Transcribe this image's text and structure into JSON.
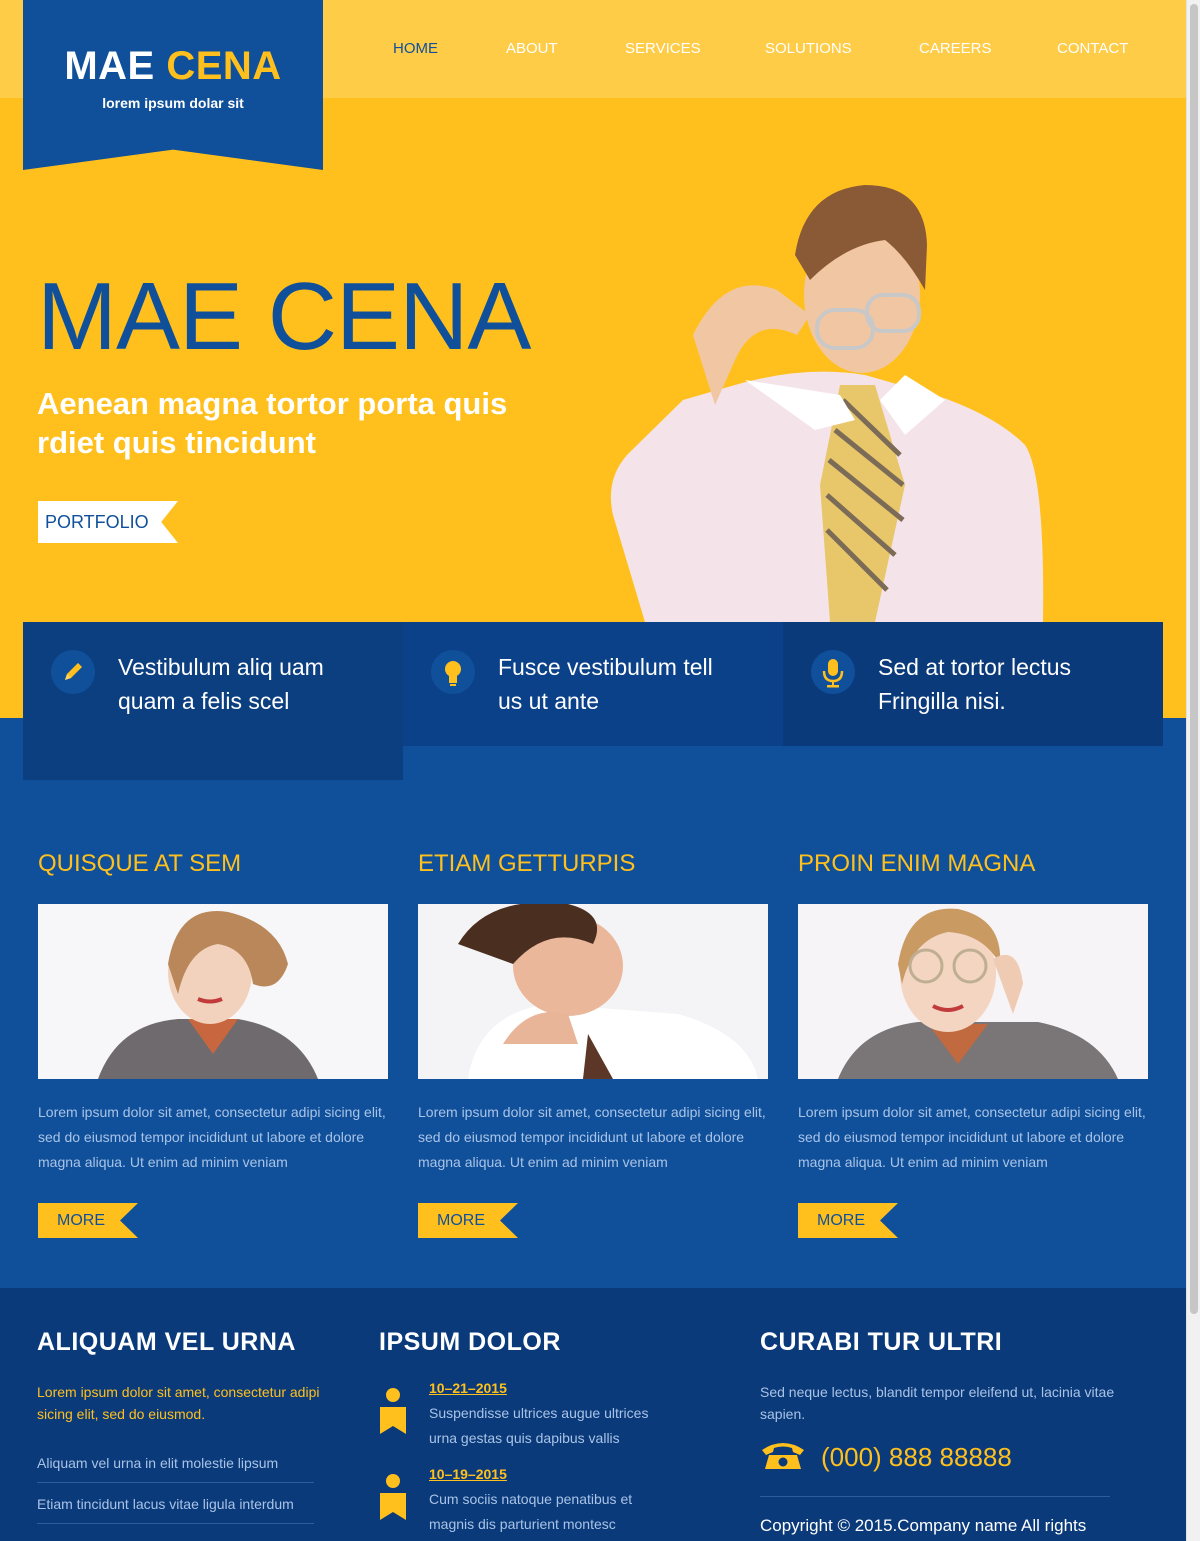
{
  "brand": {
    "name_part1": "MAE",
    "name_part2": "CENA",
    "tagline": "lorem ipsum dolar sit"
  },
  "nav": [
    {
      "label": "HOME",
      "active": true
    },
    {
      "label": "ABOUT"
    },
    {
      "label": "SERVICES"
    },
    {
      "label": "SOLUTIONS"
    },
    {
      "label": "CAREERS"
    },
    {
      "label": "CONTACT"
    }
  ],
  "hero": {
    "title": "MAE CENA",
    "subtitle": "Aenean magna tortor porta quis rdiet quis tincidunt",
    "button": "PORTFOLIO"
  },
  "features": [
    {
      "icon": "pencil-icon",
      "text": "Vestibulum aliq uam quam a felis scel"
    },
    {
      "icon": "lightbulb-icon",
      "text": "Fusce vestibulum tell us ut ante"
    },
    {
      "icon": "microphone-icon",
      "text": "Sed at tortor lectus Fringilla nisi."
    }
  ],
  "columns": [
    {
      "title": "QUISQUE AT SEM",
      "text": "Lorem ipsum dolor sit amet, consectetur adipi sicing elit, sed do eiusmod tempor incididunt ut labore et dolore magna aliqua. Ut enim ad minim veniam",
      "button": "MORE"
    },
    {
      "title": "ETIAM GETTURPIS",
      "text": "Lorem ipsum dolor sit amet, consectetur adipi sicing elit, sed do eiusmod tempor incididunt ut labore et dolore magna aliqua. Ut enim ad minim veniam",
      "button": "MORE"
    },
    {
      "title": "PROIN ENIM MAGNA",
      "text": "Lorem ipsum dolor sit amet, consectetur adipi sicing elit, sed do eiusmod tempor incididunt ut labore et dolore magna aliqua. Ut enim ad minim veniam",
      "button": "MORE"
    }
  ],
  "footer": {
    "col1": {
      "title": "ALIQUAM VEL URNA",
      "intro": "Lorem ipsum dolor sit amet, consectetur adipi sicing elit, sed do eiusmod.",
      "links": [
        "Aliquam vel urna in elit molestie lipsum",
        "Etiam tincidunt lacus vitae ligula interdum"
      ]
    },
    "col2": {
      "title": "IPSUM DOLOR",
      "events": [
        {
          "date": "10–21–2015",
          "text": "Suspendisse ultrices augue ultrices urna gestas quis dapibus vallis"
        },
        {
          "date": "10–19–2015",
          "text": "Cum sociis natoque penatibus et magnis dis parturient montesc"
        }
      ]
    },
    "col3": {
      "title": "CURABI TUR ULTRI",
      "text": "Sed neque lectus, blandit tempor eleifend ut, lacinia vitae sapien.",
      "phone": "(000) 888 88888",
      "copyright": "Copyright © 2015.Company name All rights"
    }
  },
  "colors": {
    "yellow": "#ffc01e",
    "yellow_light": "#ffcc47",
    "blue": "#10509a",
    "blue_dark": "#0a3a7a"
  }
}
